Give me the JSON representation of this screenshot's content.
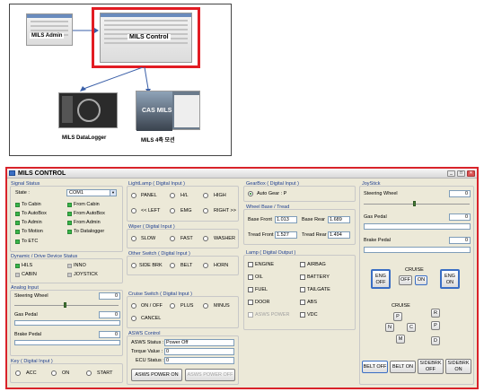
{
  "diagram": {
    "mils_admin": "MILS Admin",
    "mils_control": "MILS  Control",
    "mils_datalogger": "MILS DataLogger",
    "mils_4axis": "MILS 4축 모션",
    "cas_logo": "CAS MILS"
  },
  "window": {
    "title": "MILS CONTROL",
    "minimize": "_",
    "maximize": "□",
    "close": "✕"
  },
  "signal_status": {
    "title": "Signal Status",
    "state_label": "State :",
    "state_value": "COM1",
    "items": [
      "To Cabin",
      "From Cabin",
      "To AutoBox",
      "From AutoBox",
      "To Admin",
      "From Admin",
      "To Motion",
      "To Datalogger",
      "To ETC"
    ]
  },
  "dynamic_status": {
    "title": "Dynamic / Drive Device Status",
    "items": [
      "HILS",
      "INNO",
      "CABIN",
      "JOYSTICK"
    ]
  },
  "analog_input": {
    "title": "Analog Input",
    "steering_label": "Steering Wheel",
    "steering_value": "0",
    "gas_label": "Gas Pedal",
    "gas_value": "0",
    "brake_label": "Brake Pedal",
    "brake_value": "0"
  },
  "key_input": {
    "title": "Key ( Digital Input )",
    "options": [
      "ACC",
      "ON",
      "START"
    ]
  },
  "light_lamp": {
    "title": "LightLamp ( Digital Input )",
    "options": [
      "PANEL",
      "H/L",
      "HIGH",
      "<< LEFT",
      "EMG",
      "RIGHT >>"
    ]
  },
  "wiper": {
    "title": "Wiper ( Digital Input )",
    "options": [
      "SLOW",
      "FAST",
      "WASHER"
    ]
  },
  "other_switch": {
    "title": "Other Switch ( Digital Input )",
    "options": [
      "SIDE BRK",
      "BELT",
      "HORN"
    ]
  },
  "cruise_switch": {
    "title": "Cruise Switch ( Digital Input )",
    "options": [
      "ON / OFF",
      "PLUS",
      "MINUS",
      "CANCEL"
    ]
  },
  "asws": {
    "title": "ASWS Control",
    "status_label": "ASWS Status :",
    "status_value": "Power Off",
    "torque_label": "Torque Value :",
    "torque_value": "0",
    "ecu_label": "ECU Status :",
    "ecu_value": "0",
    "power_on": "ASWS POWER ON",
    "power_off": "ASWS POWER OFF"
  },
  "gearbox": {
    "title": "GearBox ( Digital Input )",
    "value": "Auto Gear : P"
  },
  "wheelbase": {
    "title": "Wheel Base / Tread",
    "front_label": "Base Front",
    "front_value": "1.013",
    "rear_label": "Base Rear",
    "rear_value": "1.689",
    "tread_front_label": "Tread Front",
    "tread_front_value": "1.527",
    "tread_rear_label": "Tread Rear",
    "tread_rear_value": "1.494"
  },
  "lamp": {
    "title": "Lamp ( Digital Output )",
    "items": [
      "ENGINE",
      "AIRBAG",
      "OIL",
      "BATTERY",
      "FUEL",
      "TAILGATE",
      "DOOR",
      "ABS",
      "ASWS POWER",
      "VDC"
    ]
  },
  "joystick": {
    "title": "JoyStick",
    "steering_label": "Steering Wheel",
    "steering_value": "0",
    "gas_label": "Gas Pedal",
    "gas_value": "0",
    "brake_label": "Brake Pedal",
    "brake_value": "0",
    "eng_off": "ENG OFF",
    "eng_on": "ENG ON",
    "cruise_label": "CRUISE",
    "cruise_off": "OFF",
    "cruise_on": "ON",
    "cruise2_label": "CRUISE",
    "gear_p": "P",
    "gear_r": "R",
    "gear_n": "N",
    "gear_c": "C",
    "gear_p2": "P",
    "gear_m": "M",
    "gear_d": "D",
    "belt_off": "BELT OFF",
    "belt_on": "BELT ON",
    "sidebrk_off": "SIDEBRK OFF",
    "sidebrk_on": "SIDEBRK ON"
  },
  "colors": {
    "frame_red": "#d9232a",
    "led_green": "#39b54a",
    "title_blue": "#1c3d90"
  }
}
